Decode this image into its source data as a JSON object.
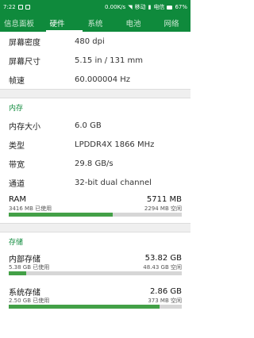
{
  "status_bar": {
    "time": "7:22",
    "speed": "0.00K/s",
    "carrier": "移动",
    "network": "电信",
    "battery": "67%"
  },
  "tabs": [
    {
      "label": "信息面板"
    },
    {
      "label": "硬件"
    },
    {
      "label": "系统"
    },
    {
      "label": "电池"
    },
    {
      "label": "网络"
    }
  ],
  "active_tab": "硬件",
  "display": [
    {
      "key": "屏幕密度",
      "value": "480 dpi"
    },
    {
      "key": "屏幕尺寸",
      "value": "5.15 in / 131 mm"
    },
    {
      "key": "帧速",
      "value": "60.000004 Hz"
    }
  ],
  "memory": {
    "title": "内存",
    "rows": [
      {
        "key": "内存大小",
        "value": "6.0 GB"
      },
      {
        "key": "类型",
        "value": "LPDDR4X 1866 MHz"
      },
      {
        "key": "带宽",
        "value": "29.8 GB/s"
      },
      {
        "key": "通道",
        "value": "32-bit dual channel"
      }
    ],
    "ram": {
      "label": "RAM",
      "total": "5711 MB",
      "used": "3416 MB 已使用",
      "free": "2294 MB 空闲",
      "fraction": 0.6
    }
  },
  "storage": {
    "title": "存储",
    "items": [
      {
        "label": "内部存储",
        "total": "53.82 GB",
        "used": "5.38 GB 已使用",
        "free": "48.43 GB 空闲",
        "fraction": 0.1
      },
      {
        "label": "系统存储",
        "total": "2.86 GB",
        "used": "2.50 GB 已使用",
        "free": "373 MB 空闲",
        "fraction": 0.87
      }
    ]
  },
  "colors": {
    "accent": "#0f8a3c",
    "bar_fill": "#43a047"
  }
}
